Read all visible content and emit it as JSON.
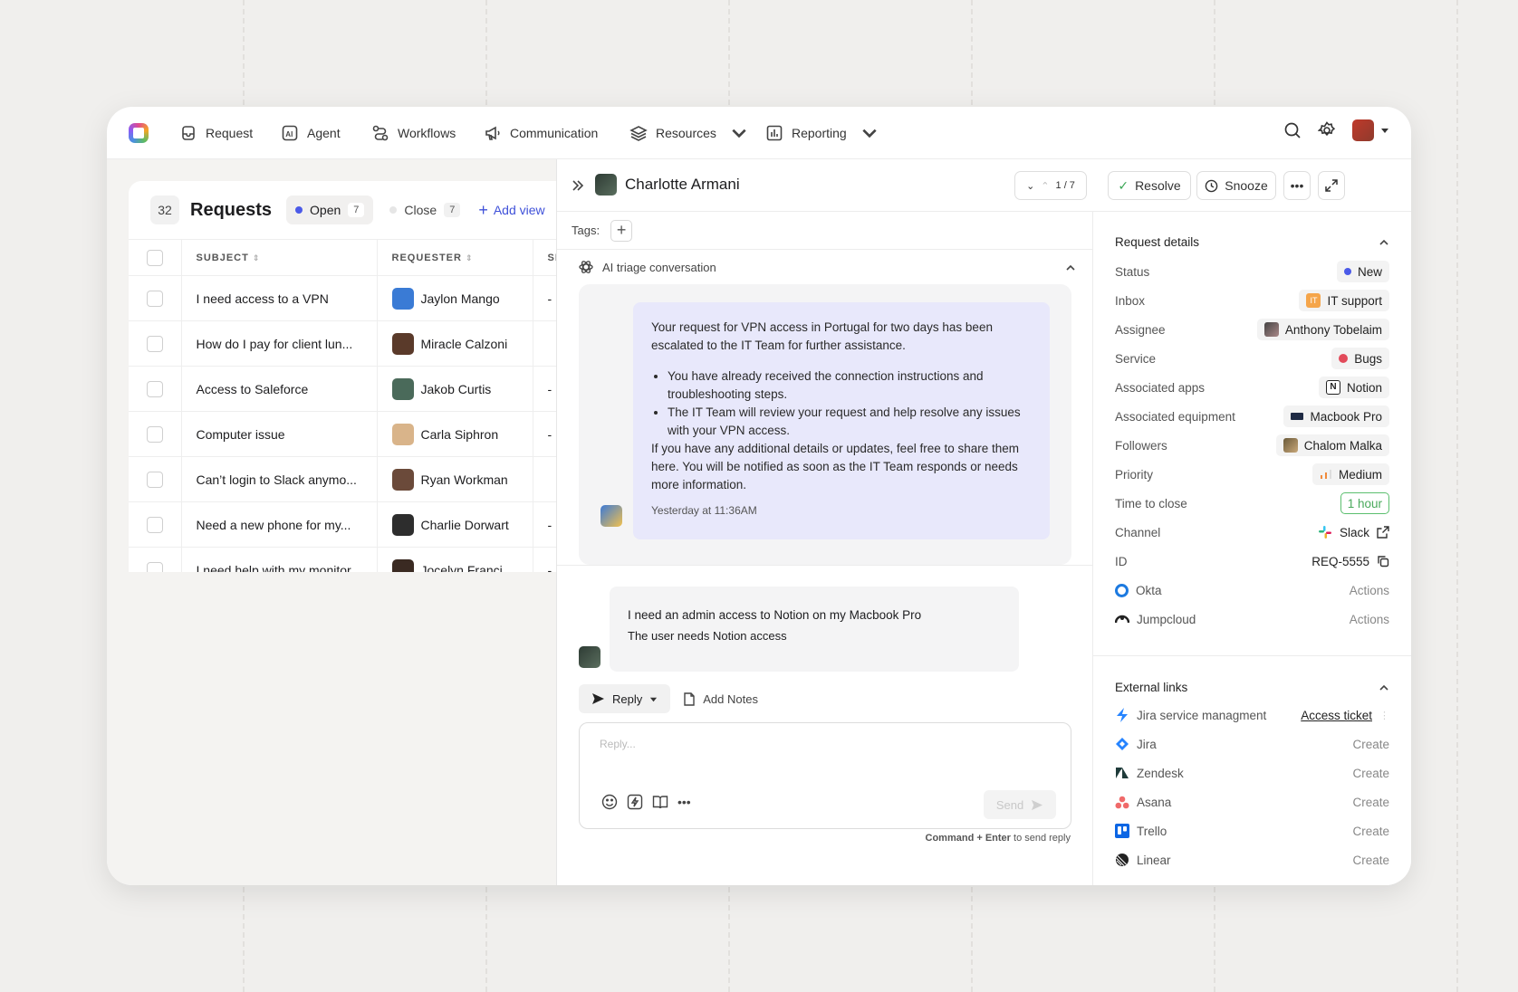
{
  "nav": {
    "items": [
      {
        "label": "Request",
        "icon": "inbox-icon"
      },
      {
        "label": "Agent",
        "icon": "ai-icon"
      },
      {
        "label": "Workflows",
        "icon": "workflow-icon"
      },
      {
        "label": "Communication",
        "icon": "megaphone-icon"
      },
      {
        "label": "Resources",
        "icon": "layers-icon"
      },
      {
        "label": "Reporting",
        "icon": "chart-icon"
      }
    ]
  },
  "requests": {
    "count": "32",
    "title": "Requests",
    "open_label": "Open",
    "open_count": "7",
    "close_label": "Close",
    "close_count": "7",
    "add_view": "Add view",
    "columns": {
      "subject": "SUBJECT",
      "requester": "REQUESTER",
      "third": "SI"
    },
    "rows": [
      {
        "subject": "I need access to a VPN",
        "requester": "Jaylon Mango",
        "third": "-",
        "color": "#3a7bd5"
      },
      {
        "subject": "How do I pay for client lun...",
        "requester": "Miracle Calzoni",
        "third": "",
        "color": "#5a3a2a"
      },
      {
        "subject": "Access to Saleforce",
        "requester": "Jakob Curtis",
        "third": "-",
        "color": "#4a6a5a"
      },
      {
        "subject": "Computer issue",
        "requester": "Carla Siphron",
        "third": "-",
        "color": "#d9b48a"
      },
      {
        "subject": "Can’t login to Slack anymo...",
        "requester": "Ryan Workman",
        "third": "",
        "color": "#6b4a3a"
      },
      {
        "subject": "Need a new phone for my...",
        "requester": "Charlie Dorwart",
        "third": "-",
        "color": "#2d2d2d"
      },
      {
        "subject": "I need help with my monitor",
        "requester": "Jocelyn Franci",
        "third": "-",
        "color": "#3a2a22"
      }
    ]
  },
  "detail": {
    "name": "Charlotte Armani",
    "pager": "1 / 7",
    "resolve": "Resolve",
    "snooze": "Snooze",
    "tags_label": "Tags:",
    "triage_label": "AI triage conversation",
    "ai_message": {
      "intro": "Your request for VPN access in Portugal for two days has been escalated to the IT Team for further assistance.",
      "bullet1": "You have already received the connection instructions and troubleshooting steps.",
      "bullet2": "The IT Team will review your request and help resolve any issues with your VPN access.",
      "outro": "If you have any additional details or updates, feel free to share them here. You will be notified as soon as the IT Team responds or needs more information.",
      "timestamp": "Yesterday at 11:36AM"
    },
    "user_message": {
      "line1": "I need an admin access to Notion on my Macbook Pro",
      "line2": "The user needs Notion access"
    },
    "reply_label": "Reply",
    "notes_label": "Add Notes",
    "reply_placeholder": "Reply...",
    "send_label": "Send",
    "hint_bold": "Command + Enter",
    "hint_rest": " to send reply"
  },
  "request_details": {
    "title": "Request details",
    "rows": [
      {
        "label": "Status",
        "value": "New"
      },
      {
        "label": "Inbox",
        "value": "IT support",
        "badge": "IT"
      },
      {
        "label": "Assignee",
        "value": "Anthony Tobelaim"
      },
      {
        "label": "Service",
        "value": "Bugs"
      },
      {
        "label": "Associated apps",
        "value": "Notion"
      },
      {
        "label": "Associated equipment",
        "value": "Macbook Pro"
      },
      {
        "label": "Followers",
        "value": "Chalom Malka"
      },
      {
        "label": "Priority",
        "value": "Medium"
      },
      {
        "label": "Time to close",
        "value": "1 hour"
      },
      {
        "label": "Channel",
        "value": "Slack"
      },
      {
        "label": "ID",
        "value": "REQ-5555"
      },
      {
        "label": "Okta",
        "value": "Actions"
      },
      {
        "label": "Jumpcloud",
        "value": "Actions"
      }
    ]
  },
  "external_links": {
    "title": "External links",
    "rows": [
      {
        "label": "Jira service managment",
        "value": "Access ticket"
      },
      {
        "label": "Jira",
        "value": "Create"
      },
      {
        "label": "Zendesk",
        "value": "Create"
      },
      {
        "label": "Asana",
        "value": "Create"
      },
      {
        "label": "Trello",
        "value": "Create"
      },
      {
        "label": "Linear",
        "value": "Create"
      }
    ]
  },
  "colors": {
    "accent": "#3f51d9",
    "open_dot": "#4b5ae8",
    "ai_bubble": "#e8e8fb"
  }
}
